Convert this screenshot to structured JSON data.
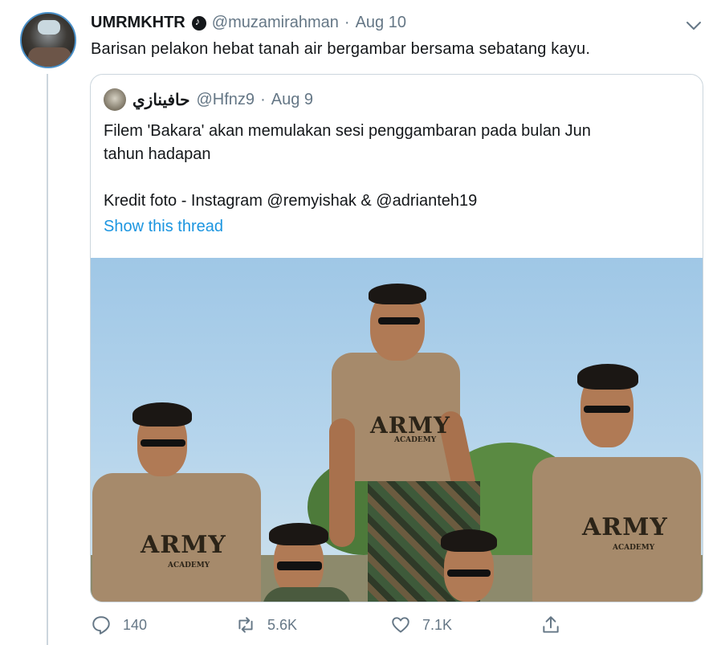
{
  "tweet": {
    "display_name": "UMRMKHTR",
    "handle": "@muzamirahman",
    "separator": "·",
    "date": "Aug 10",
    "text": "Barisan pelakon hebat tanah air bergambar bersama sebatang kayu."
  },
  "quote": {
    "display_name": "حافينازي",
    "handle": "@Hfnz9",
    "separator": "·",
    "date": "Aug 9",
    "text": "Filem 'Bakara' akan memulakan sesi penggambaran pada bulan Jun\ntahun hadapan\n\nKredit foto - Instagram @remyishak & @adrianteh19",
    "show_thread": "Show this thread",
    "photo": {
      "shirt_text": "ARMY",
      "shirt_subtext": "ACADEMY"
    }
  },
  "actions": {
    "reply_count": "140",
    "retweet_count": "5.6K",
    "like_count": "7.1K"
  },
  "colors": {
    "link": "#1b95e0",
    "muted": "#657786",
    "border": "#ccd6dd"
  }
}
